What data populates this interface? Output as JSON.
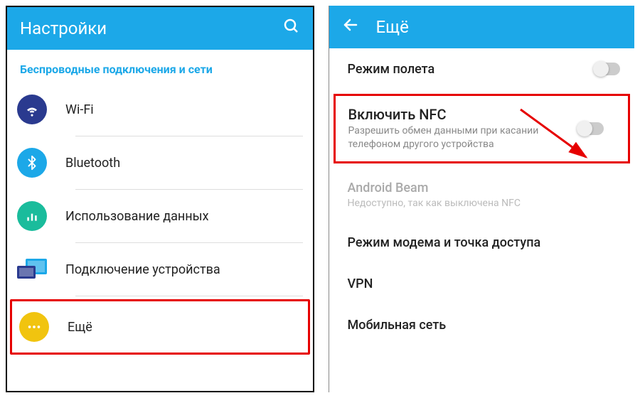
{
  "left": {
    "header_title": "Настройки",
    "section_header": "Беспроводные подключения и сети",
    "items": [
      {
        "label": "Wi-Fi",
        "icon": "wifi"
      },
      {
        "label": "Bluetooth",
        "icon": "bluetooth"
      },
      {
        "label": "Использование данных",
        "icon": "data-usage"
      },
      {
        "label": "Подключение устройства",
        "icon": "device-connect"
      },
      {
        "label": "Ещё",
        "icon": "more"
      }
    ]
  },
  "right": {
    "header_title": "Ещё",
    "airplane": {
      "title": "Режим полета"
    },
    "nfc": {
      "title": "Включить NFC",
      "subtitle": "Разрешить обмен данными при касании телефоном другого устройства"
    },
    "beam": {
      "title": "Android Beam",
      "subtitle": "Недоступно, так как выключена NFC"
    },
    "tether": {
      "title": "Режим модема и точка доступа"
    },
    "vpn": {
      "title": "VPN"
    },
    "mobile": {
      "title": "Мобильная сеть"
    }
  }
}
